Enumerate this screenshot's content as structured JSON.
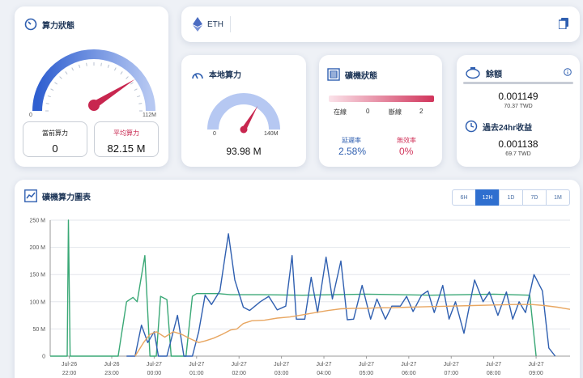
{
  "hashrate_card": {
    "title": "算力狀態",
    "gauge_min": "0",
    "gauge_max": "112M",
    "gauge_level": 0.82,
    "current_label": "當前算力",
    "current_value": "0",
    "avg_label": "平均算力",
    "avg_value": "82.15 M"
  },
  "eth_bar": {
    "coin": "ETH",
    "copy_icon": "copy-icon"
  },
  "local_card": {
    "title": "本地算力",
    "gauge_min": "0",
    "gauge_max": "140M",
    "gauge_level": 0.67,
    "value": "93.98 M"
  },
  "miner_card": {
    "title": "礦機狀態",
    "online_label": "在線",
    "online_value": "0",
    "offline_label": "斷線",
    "offline_value": "2",
    "latency_label": "延遲率",
    "latency_value": "2.58%",
    "invalid_label": "無效率",
    "invalid_value": "0%"
  },
  "balance_card": {
    "title": "餘額",
    "balance_value": "0.001149",
    "balance_twd": "70.37 TWD",
    "income_title": "過去24hr收益",
    "income_value": "0.001138",
    "income_twd": "69.7 TWD"
  },
  "chart_card": {
    "title": "礦機算力圖表",
    "ranges": [
      "6H",
      "12H",
      "1D",
      "7D",
      "1M"
    ],
    "active_range": "12H"
  },
  "colors": {
    "series_blue": "#2f5fb0",
    "series_green": "#3aa876",
    "series_orange": "#e8a661",
    "accent": "#2f6fcf",
    "danger": "#d1345b"
  },
  "chart_data": {
    "type": "line",
    "ylim": [
      0,
      250
    ],
    "yticks": [
      "0",
      "50 M",
      "100 M",
      "150 M",
      "200 M",
      "250 M"
    ],
    "xlim": [
      0,
      11.8
    ],
    "xtick_positions": [
      0,
      1,
      2,
      3,
      4,
      5,
      6,
      7,
      8,
      9,
      10,
      11
    ],
    "xticks": [
      [
        "Jul-26",
        "22:00"
      ],
      [
        "Jul-26",
        "23:00"
      ],
      [
        "Jul-27",
        "00:00"
      ],
      [
        "Jul-27",
        "01:00"
      ],
      [
        "Jul-27",
        "02:00"
      ],
      [
        "Jul-27",
        "03:00"
      ],
      [
        "Jul-27",
        "04:00"
      ],
      [
        "Jul-27",
        "05:00"
      ],
      [
        "Jul-27",
        "06:00"
      ],
      [
        "Jul-27",
        "07:00"
      ],
      [
        "Jul-27",
        "08:00"
      ],
      [
        "Jul-27",
        "09:00"
      ]
    ],
    "series": [
      {
        "color": "#3aa876",
        "points": [
          [
            -0.45,
            0
          ],
          [
            -0.05,
            0
          ],
          [
            -0.02,
            250
          ],
          [
            0.02,
            0
          ],
          [
            1.15,
            0
          ],
          [
            1.35,
            100
          ],
          [
            1.5,
            108
          ],
          [
            1.6,
            100
          ],
          [
            1.78,
            185
          ],
          [
            1.9,
            0
          ],
          [
            2.05,
            0
          ],
          [
            2.15,
            110
          ],
          [
            2.3,
            104
          ],
          [
            2.4,
            0
          ],
          [
            2.75,
            0
          ],
          [
            2.9,
            110
          ],
          [
            3.0,
            115
          ],
          [
            3.5,
            115
          ],
          [
            3.8,
            113
          ],
          [
            4.5,
            113
          ],
          [
            5.5,
            112
          ],
          [
            7,
            114
          ],
          [
            8.5,
            112
          ],
          [
            10,
            114
          ],
          [
            10.85,
            112
          ],
          [
            11.0,
            0
          ]
        ]
      },
      {
        "color": "#2f5fb0",
        "points": [
          [
            1.35,
            0
          ],
          [
            1.55,
            0
          ],
          [
            1.7,
            57
          ],
          [
            1.85,
            25
          ],
          [
            2.0,
            45
          ],
          [
            2.1,
            0
          ],
          [
            2.3,
            0
          ],
          [
            2.55,
            75
          ],
          [
            2.7,
            0
          ],
          [
            2.9,
            0
          ],
          [
            3.05,
            45
          ],
          [
            3.2,
            112
          ],
          [
            3.35,
            95
          ],
          [
            3.55,
            120
          ],
          [
            3.75,
            225
          ],
          [
            3.9,
            140
          ],
          [
            4.1,
            90
          ],
          [
            4.25,
            84
          ],
          [
            4.5,
            100
          ],
          [
            4.7,
            110
          ],
          [
            4.9,
            85
          ],
          [
            5.1,
            92
          ],
          [
            5.25,
            185
          ],
          [
            5.35,
            68
          ],
          [
            5.55,
            68
          ],
          [
            5.7,
            145
          ],
          [
            5.85,
            80
          ],
          [
            6.05,
            182
          ],
          [
            6.2,
            105
          ],
          [
            6.4,
            175
          ],
          [
            6.55,
            67
          ],
          [
            6.7,
            68
          ],
          [
            6.9,
            130
          ],
          [
            7.1,
            68
          ],
          [
            7.25,
            105
          ],
          [
            7.45,
            68
          ],
          [
            7.6,
            92
          ],
          [
            7.8,
            92
          ],
          [
            7.95,
            110
          ],
          [
            8.1,
            82
          ],
          [
            8.3,
            112
          ],
          [
            8.45,
            120
          ],
          [
            8.6,
            80
          ],
          [
            8.8,
            130
          ],
          [
            8.95,
            68
          ],
          [
            9.1,
            100
          ],
          [
            9.3,
            42
          ],
          [
            9.55,
            140
          ],
          [
            9.75,
            100
          ],
          [
            9.9,
            118
          ],
          [
            10.1,
            75
          ],
          [
            10.3,
            118
          ],
          [
            10.45,
            68
          ],
          [
            10.6,
            100
          ],
          [
            10.75,
            80
          ],
          [
            10.95,
            150
          ],
          [
            11.15,
            120
          ],
          [
            11.3,
            15
          ],
          [
            11.45,
            0
          ]
        ]
      },
      {
        "color": "#e8a661",
        "points": [
          [
            1.55,
            0
          ],
          [
            1.75,
            25
          ],
          [
            1.9,
            40
          ],
          [
            2.05,
            45
          ],
          [
            2.25,
            35
          ],
          [
            2.45,
            45
          ],
          [
            2.65,
            40
          ],
          [
            2.85,
            32
          ],
          [
            3.05,
            25
          ],
          [
            3.2,
            28
          ],
          [
            3.4,
            33
          ],
          [
            3.6,
            40
          ],
          [
            3.8,
            48
          ],
          [
            3.95,
            50
          ],
          [
            4.1,
            60
          ],
          [
            4.3,
            65
          ],
          [
            4.6,
            66
          ],
          [
            4.9,
            70
          ],
          [
            5.2,
            72
          ],
          [
            5.5,
            76
          ],
          [
            5.8,
            80
          ],
          [
            6.1,
            84
          ],
          [
            6.4,
            87
          ],
          [
            6.7,
            88
          ],
          [
            7.0,
            88
          ],
          [
            7.3,
            89
          ],
          [
            7.6,
            89
          ],
          [
            8.0,
            90
          ],
          [
            8.5,
            91
          ],
          [
            9.0,
            92
          ],
          [
            9.5,
            93
          ],
          [
            10.0,
            94
          ],
          [
            10.5,
            95
          ],
          [
            10.9,
            95
          ],
          [
            11.2,
            93
          ],
          [
            11.5,
            90
          ],
          [
            11.8,
            86
          ]
        ]
      }
    ]
  }
}
